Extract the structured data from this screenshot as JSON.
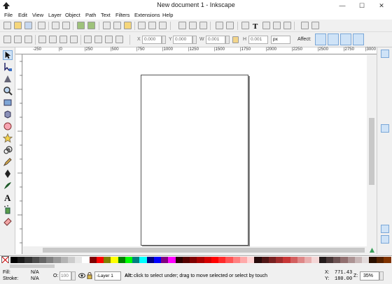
{
  "window": {
    "title": "New document 1 - Inkscape",
    "minimize": "—",
    "maximize": "☐",
    "close": "✕"
  },
  "menu": [
    "File",
    "Edit",
    "View",
    "Layer",
    "Object",
    "Path",
    "Text",
    "Filters",
    "Extensions",
    "Help"
  ],
  "toolbar2": {
    "x_label": "X",
    "x_value": "0.000",
    "y_label": "Y",
    "y_value": "0.000",
    "w_label": "W",
    "w_value": "0.001",
    "h_label": "H",
    "h_value": "0.001",
    "unit": "px",
    "affect_label": "Affect:"
  },
  "ruler": {
    "ticks": [
      "-250",
      "|0",
      "|250",
      "|500",
      "|750",
      "|1000",
      "|1250",
      "|1500",
      "|1750",
      "|2000",
      "|2250",
      "|2500",
      "|2750",
      "|3000"
    ]
  },
  "palette": {
    "colors": [
      "#000000",
      "#1a1a1a",
      "#333333",
      "#4d4d4d",
      "#666666",
      "#808080",
      "#999999",
      "#b3b3b3",
      "#cccccc",
      "#e6e6e6",
      "#ffffff",
      "#800000",
      "#ff0000",
      "#808000",
      "#ffff00",
      "#008000",
      "#00ff00",
      "#008080",
      "#00ffff",
      "#000080",
      "#0000ff",
      "#800080",
      "#ff00ff",
      "#2b0000",
      "#550000",
      "#800000",
      "#aa0000",
      "#d40000",
      "#ff0000",
      "#ff2a2a",
      "#ff5555",
      "#ff8080",
      "#ffaaaa",
      "#ffd5d5",
      "#280b0b",
      "#501616",
      "#782121",
      "#a02c2c",
      "#c83737",
      "#d35f5f",
      "#de8787",
      "#e9afaf",
      "#f4d7d7",
      "#241c1c",
      "#483737",
      "#6c5353",
      "#916f6f",
      "#ac9393",
      "#c8b7b7",
      "#e3dbdb",
      "#2b1100",
      "#552200",
      "#803300"
    ]
  },
  "status": {
    "fill_label": "Fill:",
    "fill_value": "N/A",
    "stroke_label": "Stroke:",
    "stroke_value": "N/A",
    "opacity_label": "O:",
    "opacity_value": "100",
    "layer": "-Layer 1",
    "message_bold": "Alt:",
    "message": " click to select under; drag to move selected or select by touch",
    "x_label": "X:",
    "x_value": "771.43",
    "y_label": "Y:",
    "y_value": "180.00",
    "z_label": "Z:",
    "zoom": "35%"
  }
}
